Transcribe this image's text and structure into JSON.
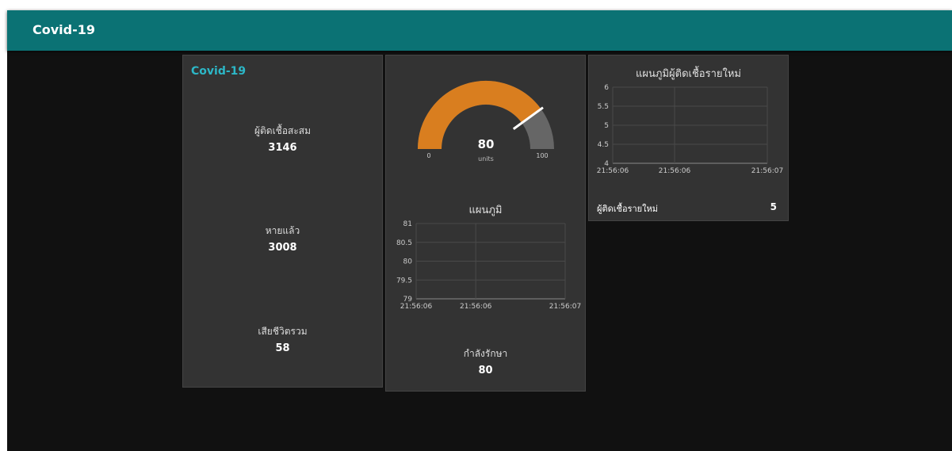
{
  "app": {
    "title": "Covid-19"
  },
  "summary_card": {
    "title": "Covid-19",
    "stats": [
      {
        "label": "ผู้ติดเชื้อสะสม",
        "value": "3146"
      },
      {
        "label": "หายแล้ว",
        "value": "3008"
      },
      {
        "label": "เสียชีวิตรวม",
        "value": "58"
      }
    ]
  },
  "gauge": {
    "value": 80,
    "min": 0,
    "max": 100,
    "units": "units",
    "value_label": "80",
    "min_label": "0",
    "max_label": "100",
    "fill_color": "#d97e1f",
    "track_color": "#666666"
  },
  "treatment": {
    "label": "กำลังรักษา",
    "value": "80"
  },
  "new_cases": {
    "label": "ผู้ติดเชื้อรายใหม่",
    "value": "5"
  },
  "chart_data": [
    {
      "type": "line",
      "title": "แผนภูมิ",
      "x_ticks": [
        "21:56:06",
        "21:56:06",
        "21:56:07"
      ],
      "y_ticks": [
        "81",
        "80.5",
        "80",
        "79.5",
        "79"
      ],
      "ylim": [
        79,
        81
      ],
      "series": [
        {
          "values": []
        }
      ],
      "grid": true
    },
    {
      "type": "line",
      "title": "แผนภูมิผู้ติดเชื้อรายใหม่",
      "x_ticks": [
        "21:56:06",
        "21:56:06",
        "21:56:07"
      ],
      "y_ticks": [
        "6",
        "5.5",
        "5",
        "4.5",
        "4"
      ],
      "ylim": [
        4,
        6
      ],
      "series": [
        {
          "values": []
        }
      ],
      "grid": true
    }
  ]
}
